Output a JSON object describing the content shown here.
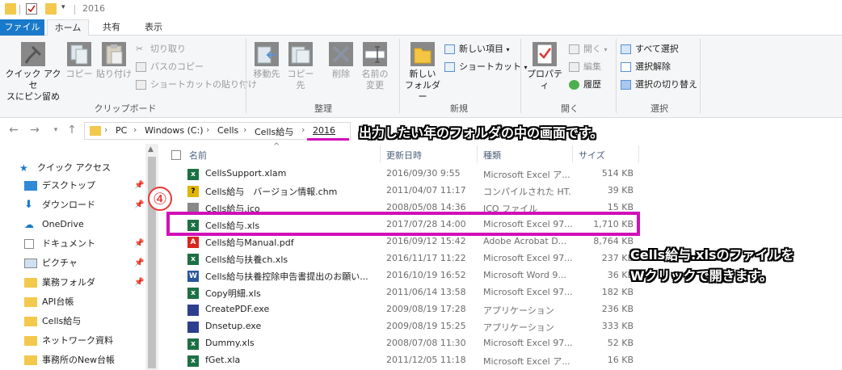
{
  "window": {
    "title": "2016"
  },
  "ribbon_tabs": [
    "ファイル",
    "ホーム",
    "共有",
    "表示"
  ],
  "ribbon": {
    "clipboard": {
      "pin_label_1": "クイック アクセ",
      "pin_label_2": "スにピン留め",
      "copy_label": "コピー",
      "paste_label": "貼り付け",
      "cut_label": "切り取り",
      "copy_path_label": "パスのコピー",
      "paste_shortcut_label": "ショートカットの貼り付け",
      "group_label": "クリップボード"
    },
    "organize": {
      "move_label": "移動先",
      "copyto_label": "コピー先",
      "delete_label": "削除",
      "rename_label_1": "名前の",
      "rename_label_2": "変更",
      "group_label": "整理"
    },
    "new": {
      "new_folder_label_1": "新しい",
      "new_folder_label_2": "フォルダー",
      "new_item_label": "新しい項目",
      "shortcut_label": "ショートカット",
      "group_label": "新規"
    },
    "open": {
      "properties_label": "プロパティ",
      "open_label": "開く",
      "edit_label": "編集",
      "history_label": "履歴",
      "group_label": "開く"
    },
    "select": {
      "select_all_label": "すべて選択",
      "select_none_label": "選択解除",
      "invert_label": "選択の切り替え",
      "group_label": "選択"
    }
  },
  "address": {
    "crumbs": [
      "PC",
      "Windows (C:)",
      "Cells",
      "Cells給与",
      "2016"
    ]
  },
  "annotations": {
    "top": "出力したい年のフォルダの中の画面です。",
    "side_line1": "Cells給与.xlsのファイルを",
    "side_line2": "Wクリックで開きます。",
    "step": "④"
  },
  "nav": {
    "quick_access": "クイック アクセス",
    "items": [
      "デスクトップ",
      "ダウンロード",
      "OneDrive",
      "ドキュメント",
      "ピクチャ",
      "業務フォルダ",
      "API台帳",
      "Cells給与",
      "ネットワーク資料",
      "事務所のNew台帳"
    ]
  },
  "columns": {
    "name": "名前",
    "date": "更新日時",
    "type": "種類",
    "size": "サイズ"
  },
  "files": [
    {
      "name": "CellsSupport.xlam",
      "date": "2016/09/30 9:55",
      "type": "Microsoft Excel ア...",
      "size": "514 KB",
      "icon": "xls"
    },
    {
      "name": "Cells給与　バージョン情報.chm",
      "date": "2011/04/07 11:17",
      "type": "コンパイルされた HT...",
      "size": "39 KB",
      "icon": "chm"
    },
    {
      "name": "Cells給与.ico",
      "date": "2008/05/08 14:36",
      "type": "ICO ファイル",
      "size": "15 KB",
      "icon": "ico"
    },
    {
      "name": "Cells給与.xls",
      "date": "2017/07/28 14:00",
      "type": "Microsoft Excel 97...",
      "size": "1,710 KB",
      "icon": "xls"
    },
    {
      "name": "Cells給与Manual.pdf",
      "date": "2016/09/12 15:42",
      "type": "Adobe Acrobat D...",
      "size": "8,764 KB",
      "icon": "pdf"
    },
    {
      "name": "Cells給与扶養ch.xls",
      "date": "2016/11/17 11:22",
      "type": "Microsoft Excel 97...",
      "size": "237 KB",
      "icon": "xls"
    },
    {
      "name": "Cells給与扶養控除申告書提出のお願い...",
      "date": "2016/10/19 16:52",
      "type": "Microsoft Word 9...",
      "size": "36 KB",
      "icon": "doc"
    },
    {
      "name": "Copy明細.xls",
      "date": "2011/06/14 13:58",
      "type": "Microsoft Excel 97...",
      "size": "182 KB",
      "icon": "xls"
    },
    {
      "name": "CreatePDF.exe",
      "date": "2009/08/19 17:28",
      "type": "アプリケーション",
      "size": "236 KB",
      "icon": "exe"
    },
    {
      "name": "Dnsetup.exe",
      "date": "2009/08/19 15:25",
      "type": "アプリケーション",
      "size": "333 KB",
      "icon": "exe"
    },
    {
      "name": "Dummy.xls",
      "date": "2008/07/08 11:30",
      "type": "Microsoft Excel 97...",
      "size": "52 KB",
      "icon": "xls"
    },
    {
      "name": "fGet.xla",
      "date": "2011/12/05 11:18",
      "type": "Microsoft Excel ア...",
      "size": "16 KB",
      "icon": "xls"
    }
  ],
  "colors": {
    "highlight": "#d010b8",
    "accent": "#1979ca"
  }
}
